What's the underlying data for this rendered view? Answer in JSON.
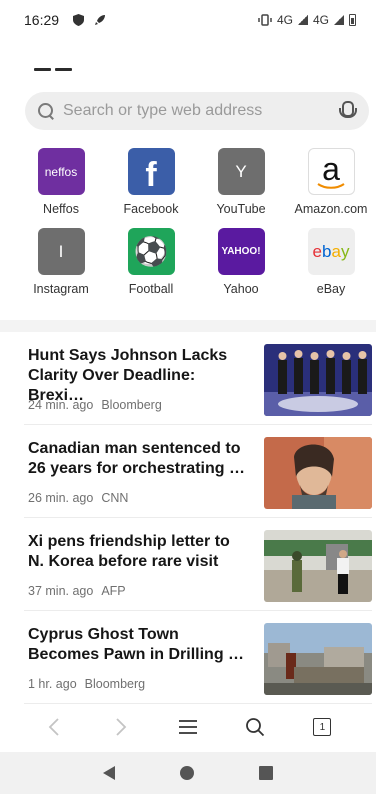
{
  "status": {
    "time": "16:29",
    "network": "4G",
    "network2": "4G"
  },
  "search": {
    "placeholder": "Search or type web address"
  },
  "shortcuts": [
    {
      "label": "Neffos",
      "glyph": "neffos",
      "color": "#6f2fa0"
    },
    {
      "label": "Facebook",
      "glyph": "f",
      "color": "#3b5ea8"
    },
    {
      "label": "YouTube",
      "glyph": "Y",
      "color": "#6e6e6e"
    },
    {
      "label": "Amazon.com",
      "glyph": "a",
      "color": "#ffffff"
    },
    {
      "label": "Instagram",
      "glyph": "I",
      "color": "#6e6e6e"
    },
    {
      "label": "Football",
      "glyph": "⚽",
      "color": "#1fa55a"
    },
    {
      "label": "Yahoo",
      "glyph": "YAHOO!",
      "color": "#5a1aa0"
    },
    {
      "label": "eBay",
      "glyph": "ebay",
      "color": "#eeeeee"
    }
  ],
  "news": [
    {
      "title": "Hunt Says Johnson Lacks Clarity Over Deadline: Brexi…",
      "time": "24 min. ago",
      "source": "Bloomberg"
    },
    {
      "title": "Canadian man sentenced to 26 years for orchestrating …",
      "time": "26 min. ago",
      "source": "CNN"
    },
    {
      "title": "Xi pens friendship letter to N. Korea before rare visit",
      "time": "37 min. ago",
      "source": "AFP"
    },
    {
      "title": "Cyprus Ghost Town Becomes Pawn in Drilling …",
      "time": "1 hr. ago",
      "source": "Bloomberg"
    }
  ],
  "toolbar": {
    "tab_count": "1"
  }
}
